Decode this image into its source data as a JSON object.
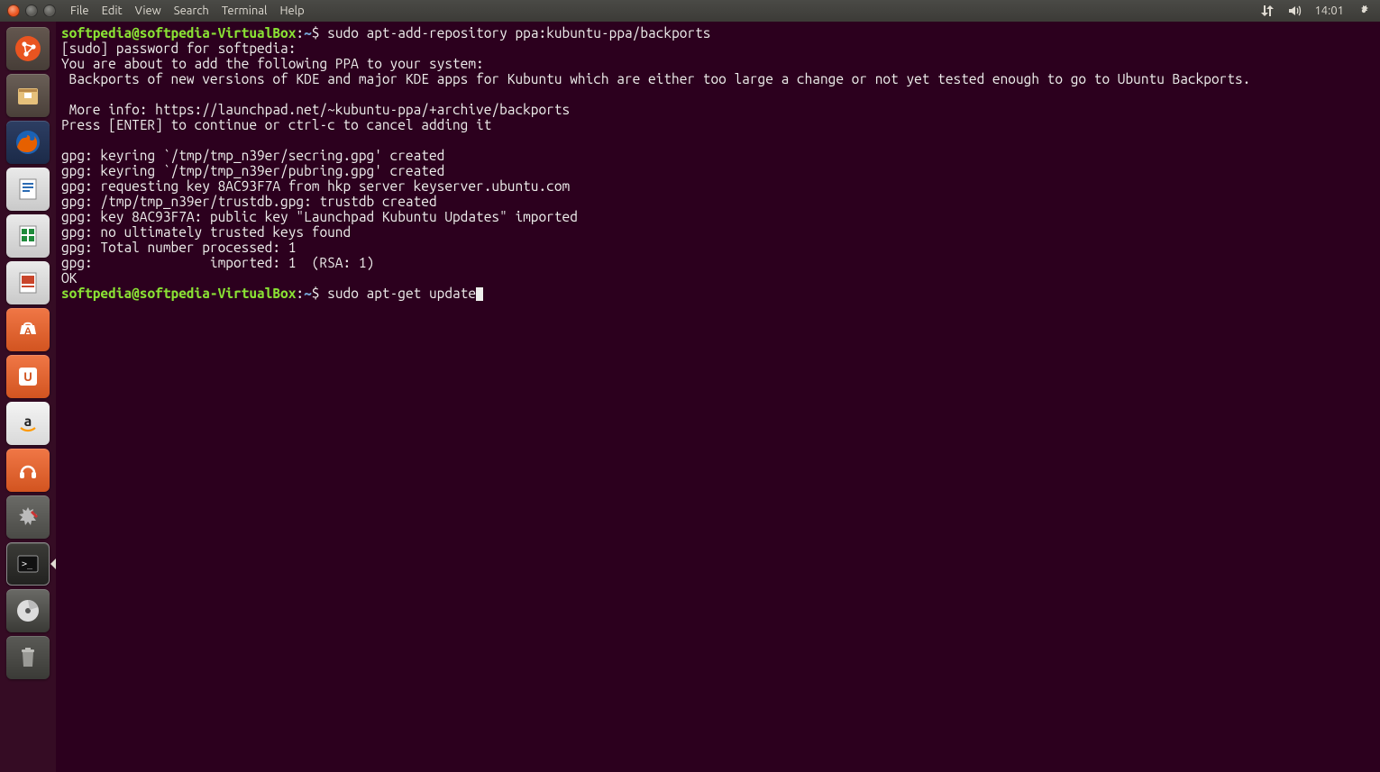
{
  "menubar": {
    "items": [
      "File",
      "Edit",
      "View",
      "Search",
      "Terminal",
      "Help"
    ]
  },
  "panel": {
    "clock": "14:01"
  },
  "launcher": {
    "items": [
      {
        "name": "dash"
      },
      {
        "name": "files"
      },
      {
        "name": "firefox"
      },
      {
        "name": "writer"
      },
      {
        "name": "calc"
      },
      {
        "name": "impress"
      },
      {
        "name": "software-center"
      },
      {
        "name": "ubuntu-one"
      },
      {
        "name": "amazon"
      },
      {
        "name": "music"
      },
      {
        "name": "settings"
      },
      {
        "name": "terminal"
      },
      {
        "name": "disc"
      },
      {
        "name": "trash"
      }
    ]
  },
  "terminal": {
    "prompt_user_host": "softpedia@softpedia-VirtualBox",
    "prompt_path": "~",
    "lines": {
      "l0_cmd": "sudo apt-add-repository ppa:kubuntu-ppa/backports",
      "l1": "[sudo] password for softpedia: ",
      "l2": "You are about to add the following PPA to your system:",
      "l3": " Backports of new versions of KDE and major KDE apps for Kubuntu which are either too large a change or not yet tested enough to go to Ubuntu Backports.",
      "l4": "",
      "l5": " More info: https://launchpad.net/~kubuntu-ppa/+archive/backports",
      "l6": "Press [ENTER] to continue or ctrl-c to cancel adding it",
      "l7": "",
      "l8": "gpg: keyring `/tmp/tmp_n39er/secring.gpg' created",
      "l9": "gpg: keyring `/tmp/tmp_n39er/pubring.gpg' created",
      "l10": "gpg: requesting key 8AC93F7A from hkp server keyserver.ubuntu.com",
      "l11": "gpg: /tmp/tmp_n39er/trustdb.gpg: trustdb created",
      "l12": "gpg: key 8AC93F7A: public key \"Launchpad Kubuntu Updates\" imported",
      "l13": "gpg: no ultimately trusted keys found",
      "l14": "gpg: Total number processed: 1",
      "l15": "gpg:               imported: 1  (RSA: 1)",
      "l16": "OK",
      "l17_cmd": "sudo apt-get update"
    }
  }
}
